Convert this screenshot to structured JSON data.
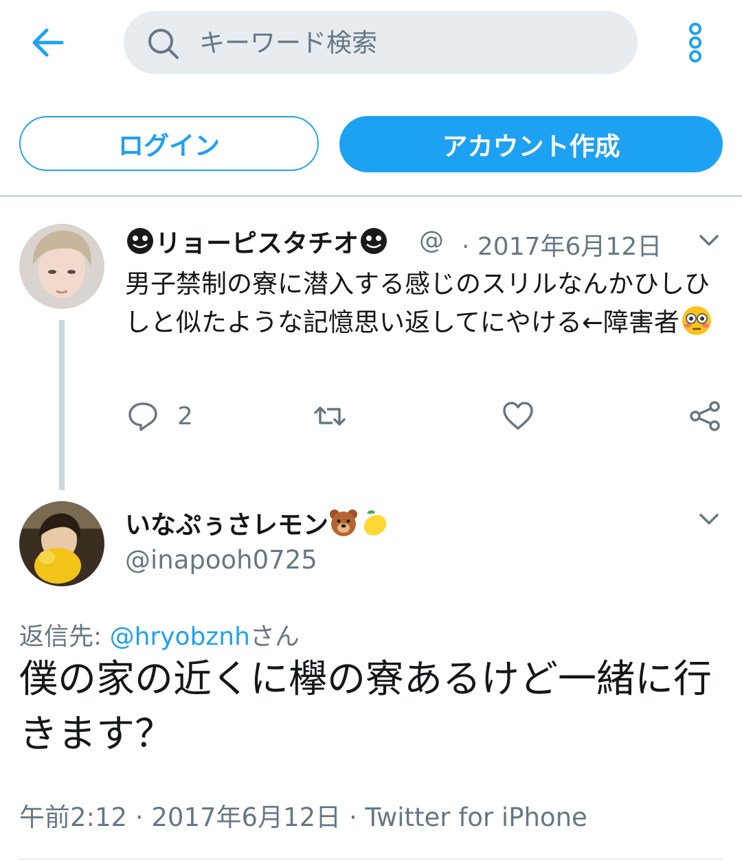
{
  "header": {
    "search_placeholder": "キーワード検索"
  },
  "auth": {
    "login_label": "ログイン",
    "signup_label": "アカウント作成"
  },
  "tweet1": {
    "name": "リョーピスタチオ",
    "handle": "@",
    "date": "· 2017年6月12日",
    "text": "男子禁制の寮に潜入する感じのスリルなんかひしひしと似たような記憶思い返してにやける←障害者",
    "reply_count": "2",
    "icons": [
      "reply-icon",
      "retweet-icon",
      "like-icon",
      "share-icon"
    ]
  },
  "tweet2": {
    "name": "いなぷぅさレモン",
    "handle": "@inapooh0725",
    "replying_prefix": "返信先: ",
    "replying_mention": "@hryobznh",
    "replying_suffix": "さん",
    "text": "僕の家の近くに欅の寮あるけど一緒に行きます？",
    "time": "午前2:12",
    "date": "2017年6月12日",
    "source": "Twitter for iPhone",
    "sep": " · "
  },
  "colors": {
    "accent": "#1da1f2",
    "secondary_text": "#657786",
    "divider": "#ccd6dd",
    "search_bg": "#e6ecf0"
  }
}
